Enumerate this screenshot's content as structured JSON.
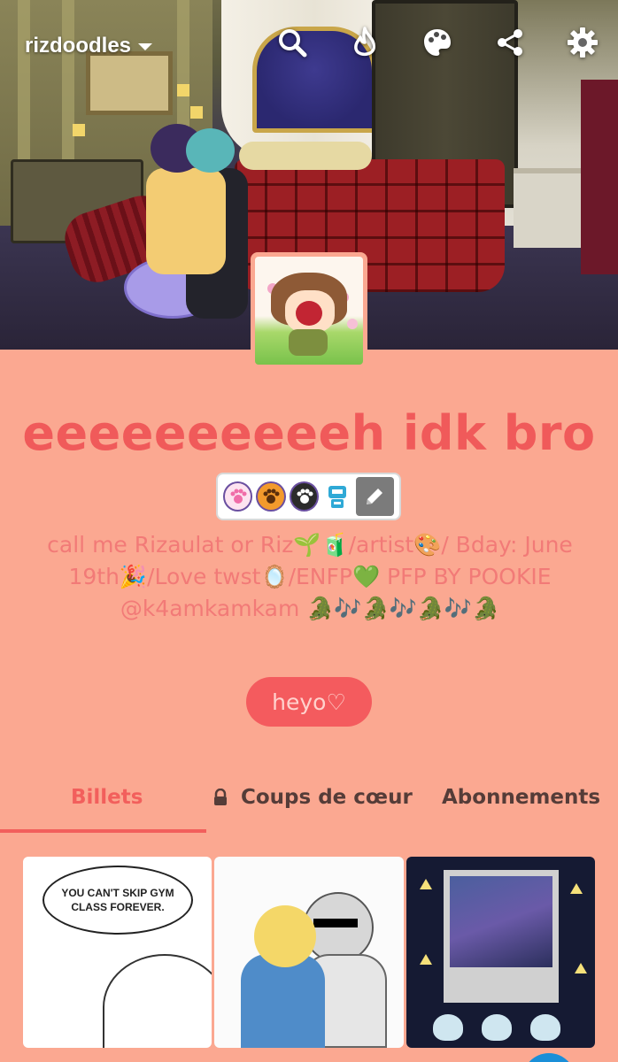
{
  "header": {
    "blog_name": "rizdoodles",
    "icons": [
      "search-icon",
      "activity-flame-icon",
      "palette-icon",
      "share-icon",
      "settings-gear-icon"
    ]
  },
  "profile": {
    "title": "eeeeeeeeeeh idk bro",
    "badges": [
      "paw-badge-pink",
      "paw-badge-orange",
      "paw-badge-dark",
      "robot-badge"
    ],
    "bio": "call me Rizaulat or Riz🌱🧃/artist🎨/ Bday: June 19th🎉/Love twst🪞/ENFP💚 PFP BY POOKIE @k4amkamkam 🐊🎶🐊🎶🐊🎶🐊",
    "button_label": "heyo♡"
  },
  "tabs": [
    {
      "label": "Billets",
      "active": true
    },
    {
      "label": "Coups de cœur",
      "locked": true
    },
    {
      "label": "Abonnements"
    }
  ],
  "posts": [
    {
      "caption": "YOU CAN'T SKIP GYM CLASS FOREVER."
    },
    {
      "caption": ""
    },
    {
      "caption": ""
    }
  ],
  "colors": {
    "background": "#fba891",
    "accent": "#f25f5c",
    "bio_text": "#f27a77",
    "tab_text": "#553c38"
  }
}
